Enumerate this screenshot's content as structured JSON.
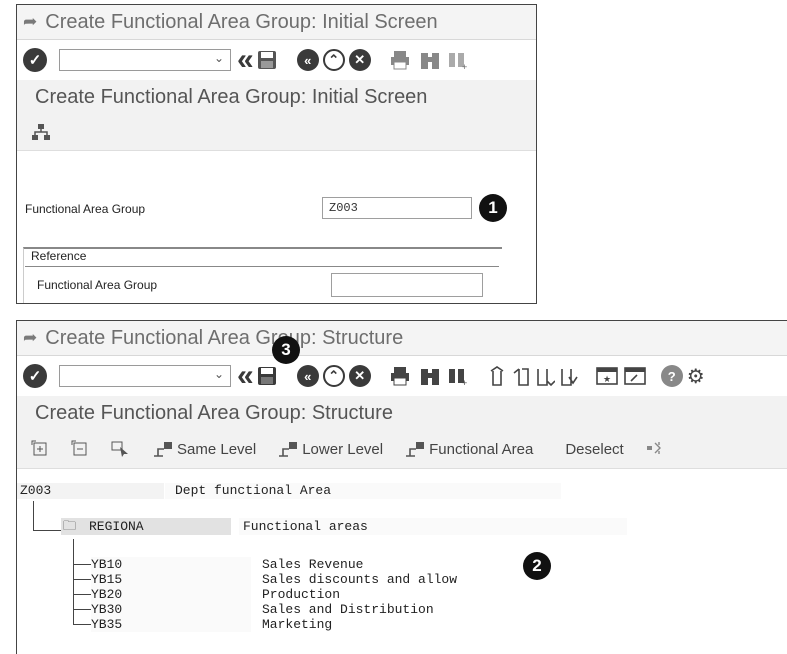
{
  "top": {
    "window_title": "Create Functional Area Group: Initial Screen",
    "screen_title": "Create Functional Area Group: Initial Screen",
    "group_label": "Functional Area Group",
    "group_value": "Z003",
    "reference_title": "Reference",
    "reference_label": "Functional Area Group",
    "reference_value": "",
    "badge": "1"
  },
  "bottom": {
    "window_title": "Create Functional Area Group: Structure",
    "screen_title": "Create Functional Area Group: Structure",
    "badge_save": "3",
    "badge_tree": "2",
    "app_buttons": {
      "same_level": "Same Level",
      "lower_level": "Lower Level",
      "functional_area": "Functional Area",
      "deselect": "Deselect"
    },
    "root": {
      "code": "Z003",
      "text": "Dept functional Area"
    },
    "node": {
      "code": "REGIONA",
      "text": "Functional areas"
    },
    "leaves": [
      {
        "code": "YB10",
        "text": "Sales Revenue"
      },
      {
        "code": "YB15",
        "text": "Sales discounts and allow"
      },
      {
        "code": "YB20",
        "text": "Production"
      },
      {
        "code": "YB30",
        "text": "Sales and Distribution"
      },
      {
        "code": "YB35",
        "text": "Marketing"
      }
    ]
  },
  "icons": {
    "exit": "exit-icon",
    "enter": "checkmark-icon",
    "back": "double-left-icon",
    "save": "save-icon",
    "cancel": "cancel-icon",
    "print": "print-icon",
    "find": "binoculars-icon",
    "help": "help-icon",
    "hierarchy": "hierarchy-icon"
  }
}
